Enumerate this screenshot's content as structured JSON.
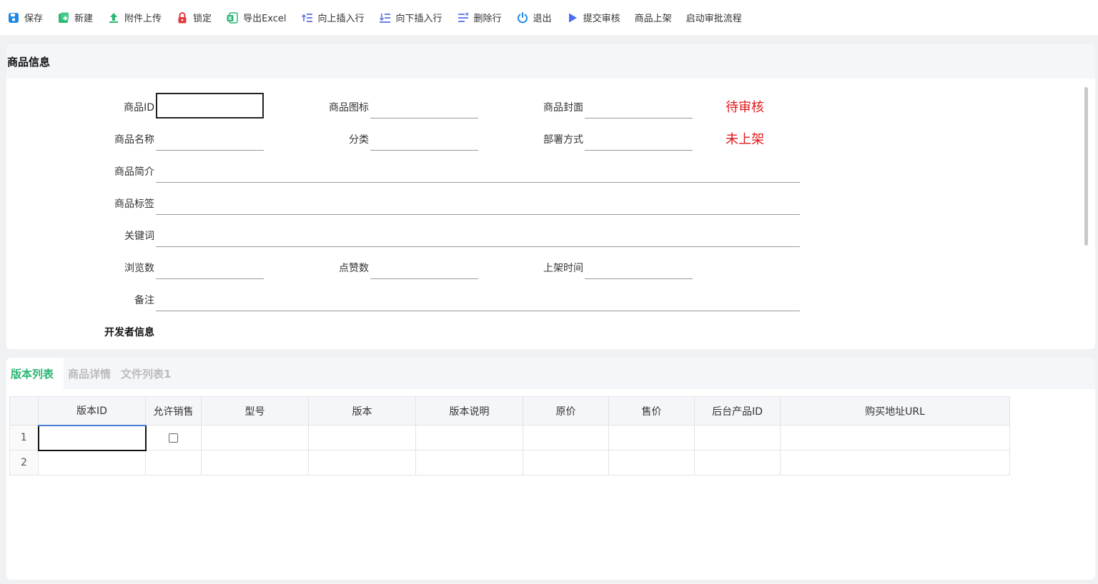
{
  "toolbar": {
    "buttons": [
      {
        "label": "保存",
        "icon": "save-icon",
        "color": "#1e88e5"
      },
      {
        "label": "新建",
        "icon": "new-icon",
        "color": "#2bb673"
      },
      {
        "label": "附件上传",
        "icon": "upload-icon",
        "color": "#2bb673"
      },
      {
        "label": "锁定",
        "icon": "lock-icon",
        "color": "#e5393a"
      },
      {
        "label": "导出Excel",
        "icon": "excel-icon",
        "color": "#2bb673"
      },
      {
        "label": "向上插入行",
        "icon": "insert-up-icon",
        "color": "#6b7fe8"
      },
      {
        "label": "向下插入行",
        "icon": "insert-down-icon",
        "color": "#6b7fe8"
      },
      {
        "label": "删除行",
        "icon": "delete-row-icon",
        "color": "#6b7fe8"
      },
      {
        "label": "退出",
        "icon": "power-icon",
        "color": "#1e88e5"
      },
      {
        "label": "提交审核",
        "icon": "play-icon",
        "color": "#4a6cf0"
      },
      {
        "label": "商品上架"
      },
      {
        "label": "启动审批流程"
      }
    ]
  },
  "form": {
    "title": "商品信息",
    "fields": {
      "product_id": {
        "label": "商品ID",
        "value": ""
      },
      "product_icon": {
        "label": "商品图标",
        "value": ""
      },
      "product_cover": {
        "label": "商品封面",
        "value": ""
      },
      "product_name": {
        "label": "商品名称",
        "value": ""
      },
      "category": {
        "label": "分类",
        "value": ""
      },
      "deploy_mode": {
        "label": "部署方式",
        "value": ""
      },
      "intro": {
        "label": "商品简介",
        "value": ""
      },
      "tags": {
        "label": "商品标签",
        "value": ""
      },
      "keywords": {
        "label": "关键词",
        "value": ""
      },
      "views": {
        "label": "浏览数",
        "value": ""
      },
      "likes": {
        "label": "点赞数",
        "value": ""
      },
      "listed_time": {
        "label": "上架时间",
        "value": ""
      },
      "remarks": {
        "label": "备注",
        "value": ""
      }
    },
    "status_review": "待审核",
    "status_listing": "未上架",
    "section_developer": "开发者信息",
    "status_color": "#e01818"
  },
  "tabs": [
    {
      "label": "版本列表",
      "active": true
    },
    {
      "label": "商品详情",
      "active": false
    },
    {
      "label": "文件列表1",
      "active": false
    }
  ],
  "grid": {
    "columns": [
      "版本ID",
      "允许销售",
      "型号",
      "版本",
      "版本说明",
      "原价",
      "售价",
      "后台产品ID",
      "购买地址URL"
    ],
    "rows": [
      {
        "num": "1",
        "cells": [
          "",
          "",
          "",
          "",
          "",
          "",
          "",
          "",
          ""
        ]
      },
      {
        "num": "2",
        "cells": [
          "",
          "",
          "",
          "",
          "",
          "",
          "",
          "",
          ""
        ]
      }
    ]
  }
}
